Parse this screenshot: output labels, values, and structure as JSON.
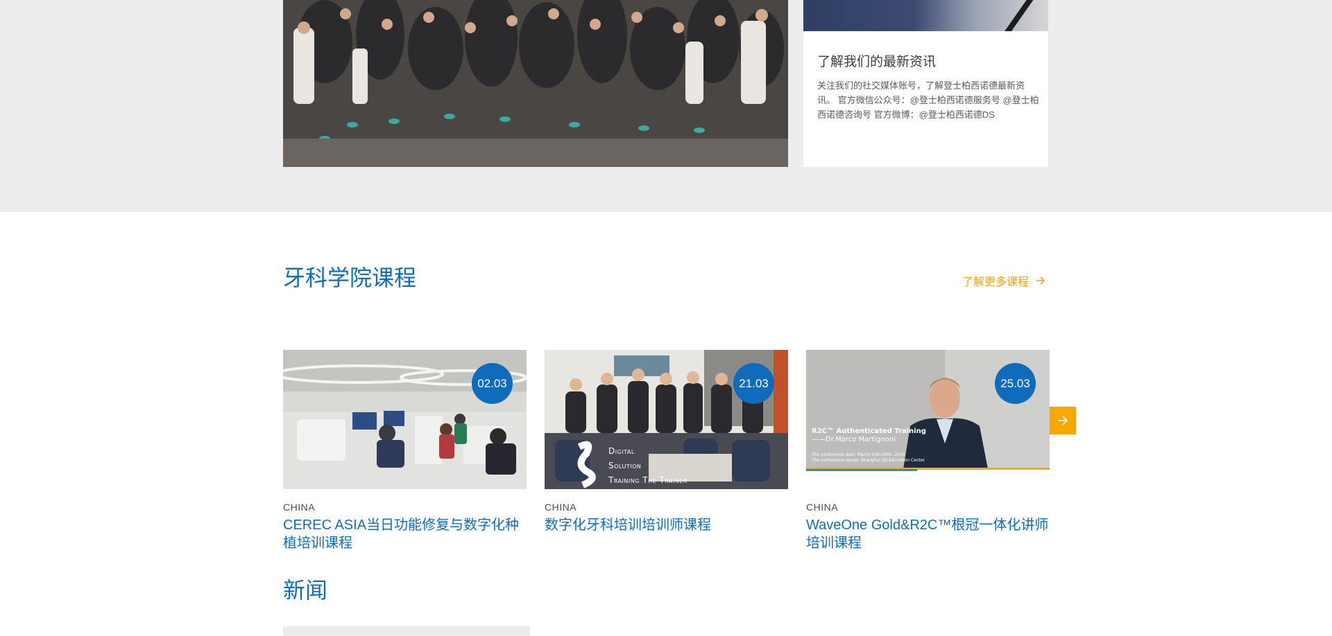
{
  "news_card": {
    "title": "了解我们的最新资讯",
    "text": "关注我们的社交媒体账号，了解登士柏西诺德最新资讯。 官方微信公众号：@登士柏西诺德服务号 @登士柏西诺德咨询号 官方微博：@登士柏西诺德DS"
  },
  "courses": {
    "section_title": "牙科学院课程",
    "more_link_label": "了解更多课程",
    "items": [
      {
        "date": "02.03",
        "region": "CHINA",
        "title": "CEREC ASIA当日功能修复与数字化种植培训课程"
      },
      {
        "date": "21.03",
        "region": "CHINA",
        "title": "数字化牙科培训培训师课程",
        "image_overlay": [
          "Digital",
          "Solution",
          "Training The Trainer"
        ]
      },
      {
        "date": "25.03",
        "region": "CHINA",
        "title": "WaveOne Gold&R2C™根冠一体化讲师培训课程",
        "image_overlay": [
          "R2C™ Authenticated Training",
          "——Dr.Marco Martignoni",
          "The conference date: March 25th-26th ,2019",
          "The conference venue: Shanghai DS Education Center"
        ]
      }
    ]
  },
  "news": {
    "heading": "新闻"
  },
  "icons": {
    "more_arrow": "arrow-right-icon",
    "carousel_next": "arrow-right-icon"
  },
  "colors": {
    "brand_blue": "#0f6cbd",
    "accent_orange": "#f5a800",
    "link_orange": "#f0a30a"
  }
}
